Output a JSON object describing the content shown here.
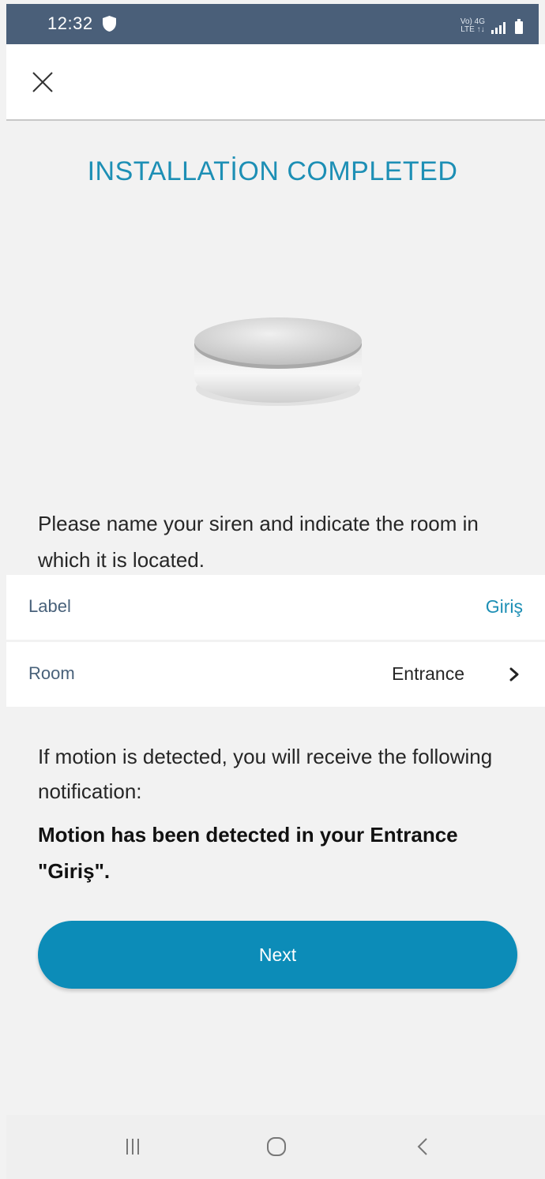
{
  "status_bar": {
    "time": "12:32",
    "network_top": "Vo) 4G",
    "network_bottom": "LTE ↑↓",
    "shield_icon": "shield-icon",
    "signal_icon": "signal-icon",
    "battery_icon": "battery-icon"
  },
  "app_bar": {
    "close_icon": "close-icon"
  },
  "page": {
    "title": "INSTALLATİON COMPLETED",
    "device_image": "siren-device-image",
    "instruction": "Please name your siren and indicate the room in which it is located."
  },
  "fields": {
    "label": {
      "name": "Label",
      "value": "Giriş"
    },
    "room": {
      "name": "Room",
      "value": "Entrance",
      "icon": "chevron-right-icon"
    }
  },
  "notice": {
    "text": "If motion is detected, you will receive the following notification:",
    "message": "Motion has been detected in your Entrance \"Giriş\"."
  },
  "actions": {
    "next_label": "Next"
  },
  "nav_bar": {
    "recents_icon": "recents-icon",
    "home_icon": "home-icon",
    "back_icon": "back-icon"
  },
  "colors": {
    "accent": "#1d8fb5",
    "button": "#0c8cb8",
    "status_bar": "#4a5f79",
    "background": "#f2f2f2"
  }
}
